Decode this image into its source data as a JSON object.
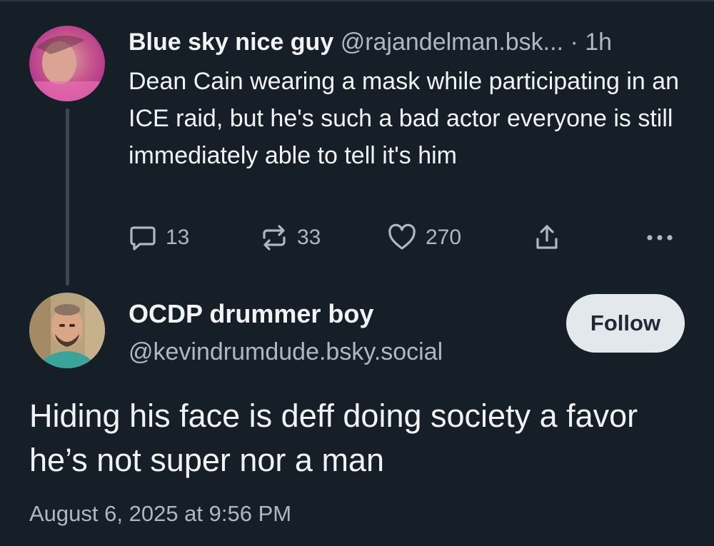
{
  "colors": {
    "background": "#161e27",
    "text_primary": "#f1f3f5",
    "text_secondary": "#aeb8c4",
    "follow_button_bg": "#e3e8ed",
    "follow_button_text": "#1f2a36",
    "thread_line": "#3b4754"
  },
  "parent_post": {
    "author_name": "Blue sky nice guy",
    "author_handle": "@rajandelman.bsk...",
    "separator": "·",
    "time_ago": "1h",
    "text": "Dean Cain wearing a mask while participating in an ICE raid, but he's such a bad actor everyone is still immediately able to tell it's him",
    "actions": {
      "reply": {
        "icon": "reply-bubble-icon",
        "count": "13"
      },
      "repost": {
        "icon": "repost-icon",
        "count": "33"
      },
      "like": {
        "icon": "heart-icon",
        "count": "270"
      },
      "share": {
        "icon": "share-icon"
      },
      "more": {
        "icon": "more-dots-icon"
      }
    }
  },
  "reply_post": {
    "author_name": "OCDP drummer boy",
    "author_handle": "@kevindrumdude.bsky.social",
    "follow_label": "Follow",
    "text": "Hiding his face is deff doing society a favor he’s not super nor a man",
    "timestamp": "August 6, 2025 at 9:56 PM"
  }
}
